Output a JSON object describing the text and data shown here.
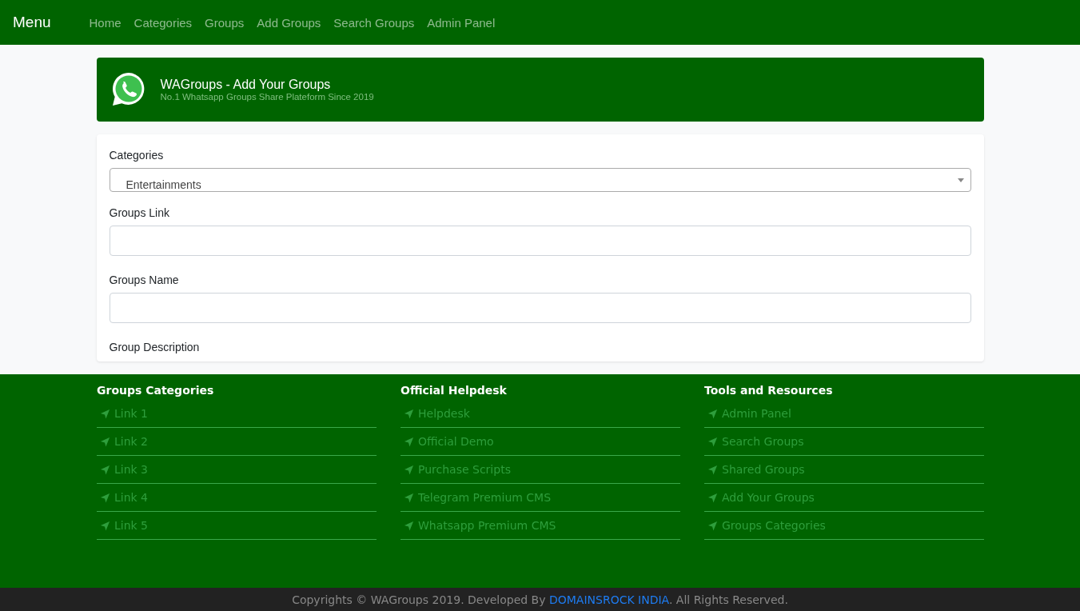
{
  "navbar": {
    "brand": "Menu",
    "links": [
      "Home",
      "Categories",
      "Groups",
      "Add Groups",
      "Search Groups",
      "Admin Panel"
    ]
  },
  "banner": {
    "title": "WAGroups - Add Your Groups",
    "subtitle": "No.1 Whatsapp Groups Share Plateform Since 2019"
  },
  "form": {
    "fields": [
      {
        "kind": "select",
        "label": "Categories",
        "value": "Entertainments"
      },
      {
        "kind": "input",
        "label": "Groups Link"
      },
      {
        "kind": "input",
        "label": "Groups Name"
      },
      {
        "kind": "label",
        "label": "Group Description"
      }
    ]
  },
  "footer": {
    "columns": [
      {
        "heading": "Groups Categories",
        "links": [
          "Link 1",
          "Link 2",
          "Link 3",
          "Link 4",
          "Link 5"
        ]
      },
      {
        "heading": "Official Helpdesk",
        "links": [
          "Helpdesk",
          "Official Demo",
          "Purchase Scripts",
          "Telegram Premium CMS",
          "Whatsapp Premium CMS"
        ]
      },
      {
        "heading": "Tools and Resources",
        "links": [
          "Admin Panel",
          "Search Groups",
          "Shared Groups",
          "Add Your Groups",
          "Groups Categories"
        ]
      }
    ]
  },
  "copyright": {
    "before": "Copyrights © WAGroups 2019. Developed By ",
    "link": "DOMAINSROCK INDIA",
    "after": ". All Rights Reserved."
  }
}
